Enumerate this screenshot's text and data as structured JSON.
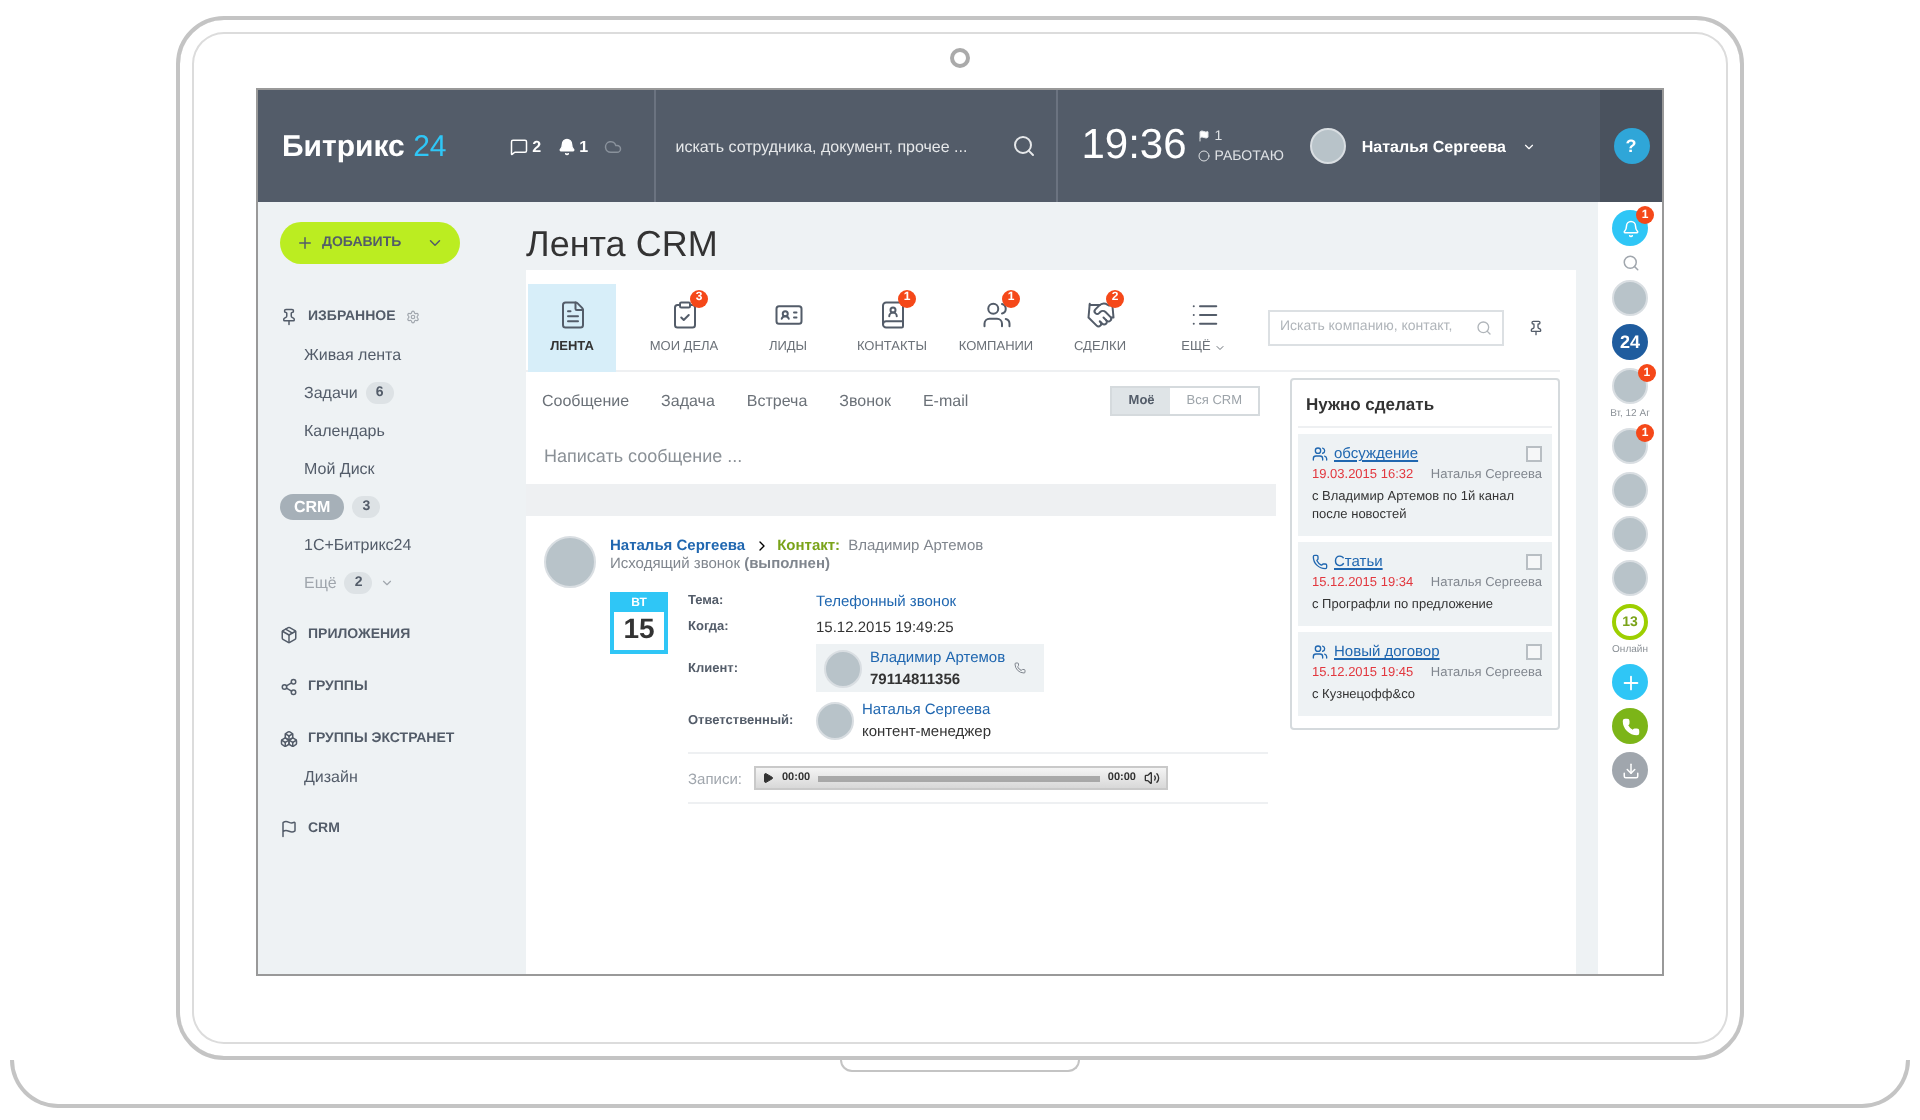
{
  "header": {
    "logo": {
      "name": "Битрикс",
      "number": "24"
    },
    "counters": [
      {
        "kind": "chat",
        "count": "2"
      },
      {
        "kind": "bell",
        "count": "1"
      }
    ],
    "search": {
      "placeholder": "искать сотрудника, документ, прочее ..."
    },
    "time": "19:36",
    "flag_count": "1",
    "status": "РАБОТАЮ",
    "user": "Наталья Сергеева",
    "help": "?"
  },
  "sidebar": {
    "add_button": "ДОБАВИТЬ",
    "sections": [
      {
        "kind": "favorites",
        "label": "ИЗБРАННОЕ",
        "children": [
          {
            "kind": "link",
            "label": "Живая лента",
            "selected": false
          },
          {
            "kind": "link",
            "label": "Задачи",
            "count": "6",
            "selected": false
          },
          {
            "kind": "link",
            "label": "Календарь",
            "selected": false
          },
          {
            "kind": "link",
            "label": "Мой Диск",
            "selected": false
          },
          {
            "kind": "link",
            "label": "CRM",
            "count": "3",
            "selected": true
          },
          {
            "kind": "link",
            "label": "1С+Битрикс24",
            "selected": false
          },
          {
            "kind": "more",
            "label": "Ещё",
            "count": "2",
            "selected": false
          }
        ]
      },
      {
        "kind": "apps",
        "label": "ПРИЛОЖЕНИЯ"
      },
      {
        "kind": "groups",
        "label": "ГРУППЫ"
      },
      {
        "kind": "extranet",
        "label": "ГРУППЫ ЭКСТРАНЕТ",
        "children": [
          {
            "kind": "link",
            "label": "Дизайн",
            "selected": false
          }
        ]
      },
      {
        "kind": "crm",
        "label": "CRM"
      }
    ]
  },
  "page_title": "Лента CRM",
  "crm_tabs": [
    {
      "kind": "feed",
      "label": "ЛЕНТА",
      "selected": true
    },
    {
      "kind": "tasks",
      "label": "МОИ ДЕЛА",
      "badge": "3",
      "selected": false
    },
    {
      "kind": "leads",
      "label": "ЛИДЫ",
      "selected": false
    },
    {
      "kind": "contacts",
      "label": "КОНТАКТЫ",
      "badge": "1",
      "selected": false
    },
    {
      "kind": "companies",
      "label": "КОМПАНИИ",
      "badge": "1",
      "selected": false
    },
    {
      "kind": "deals",
      "label": "СДЕЛКИ",
      "badge": "2",
      "selected": false
    },
    {
      "kind": "more",
      "label": "ЕЩЁ",
      "selected": false
    }
  ],
  "crm_search": {
    "placeholder": "Искать компанию, контакт,"
  },
  "action_tabs": [
    "Сообщение",
    "Задача",
    "Встреча",
    "Звонок",
    "E-mail"
  ],
  "scope": [
    {
      "label": "Моё",
      "selected": true
    },
    {
      "label": "Вся CRM",
      "selected": false
    }
  ],
  "compose": {
    "placeholder": "Написать сообщение ..."
  },
  "post": {
    "author": "Наталья Сергеева",
    "contact_label": "Контакт:",
    "contact": "Владимир Артемов",
    "subtitle": "Исходящий звонок **(выполнен)**",
    "date": {
      "weekday": "ВТ",
      "day": "15"
    },
    "topic_label": "Тема:",
    "topic": "Телефонный звонок",
    "when_label": "Когда:",
    "when": "15.12.2015 19:49:25",
    "client_label": "Клиент:",
    "client": {
      "name": "Владимир Артемов",
      "phone": "79114811356"
    },
    "responsible_label": "Ответственный:",
    "responsible": {
      "name": "Наталья Сергеева",
      "role": "контент-менеджер"
    },
    "records_label": "Записи:",
    "player": {
      "current": "00:00",
      "total": "00:00"
    }
  },
  "todo": {
    "title": "Нужно сделать",
    "items": [
      {
        "kind": "meeting",
        "title": "обсуждение",
        "date": "19.03.2015 16:32",
        "author": "Наталья Сергеева",
        "text": "с Владимир Артемов по 1й канал после новостей",
        "checked": false
      },
      {
        "kind": "call",
        "title": "Статьи",
        "date": "15.12.2015 19:34",
        "author": "Наталья Сергеева",
        "text": "с Прографли по предложение",
        "checked": false
      },
      {
        "kind": "meeting",
        "title": "Новый договор",
        "date": "15.12.2015 19:45",
        "author": "Наталья Сергеева",
        "text": "с Кузнецофф&co",
        "checked": false
      }
    ]
  },
  "right_bar": [
    {
      "kind": "bell",
      "badge": "1"
    },
    {
      "kind": "search"
    },
    {
      "kind": "avatar"
    },
    {
      "kind": "logo",
      "label": "24"
    },
    {
      "kind": "avatar",
      "badge": "1",
      "caption": "Вт, 12 Аг"
    },
    {
      "kind": "avatar",
      "badge": "1"
    },
    {
      "kind": "avatar"
    },
    {
      "kind": "avatar"
    },
    {
      "kind": "avatar"
    },
    {
      "kind": "online",
      "label": "13",
      "caption": "Онлайн"
    },
    {
      "kind": "plus"
    },
    {
      "kind": "phone"
    },
    {
      "kind": "download"
    }
  ]
}
